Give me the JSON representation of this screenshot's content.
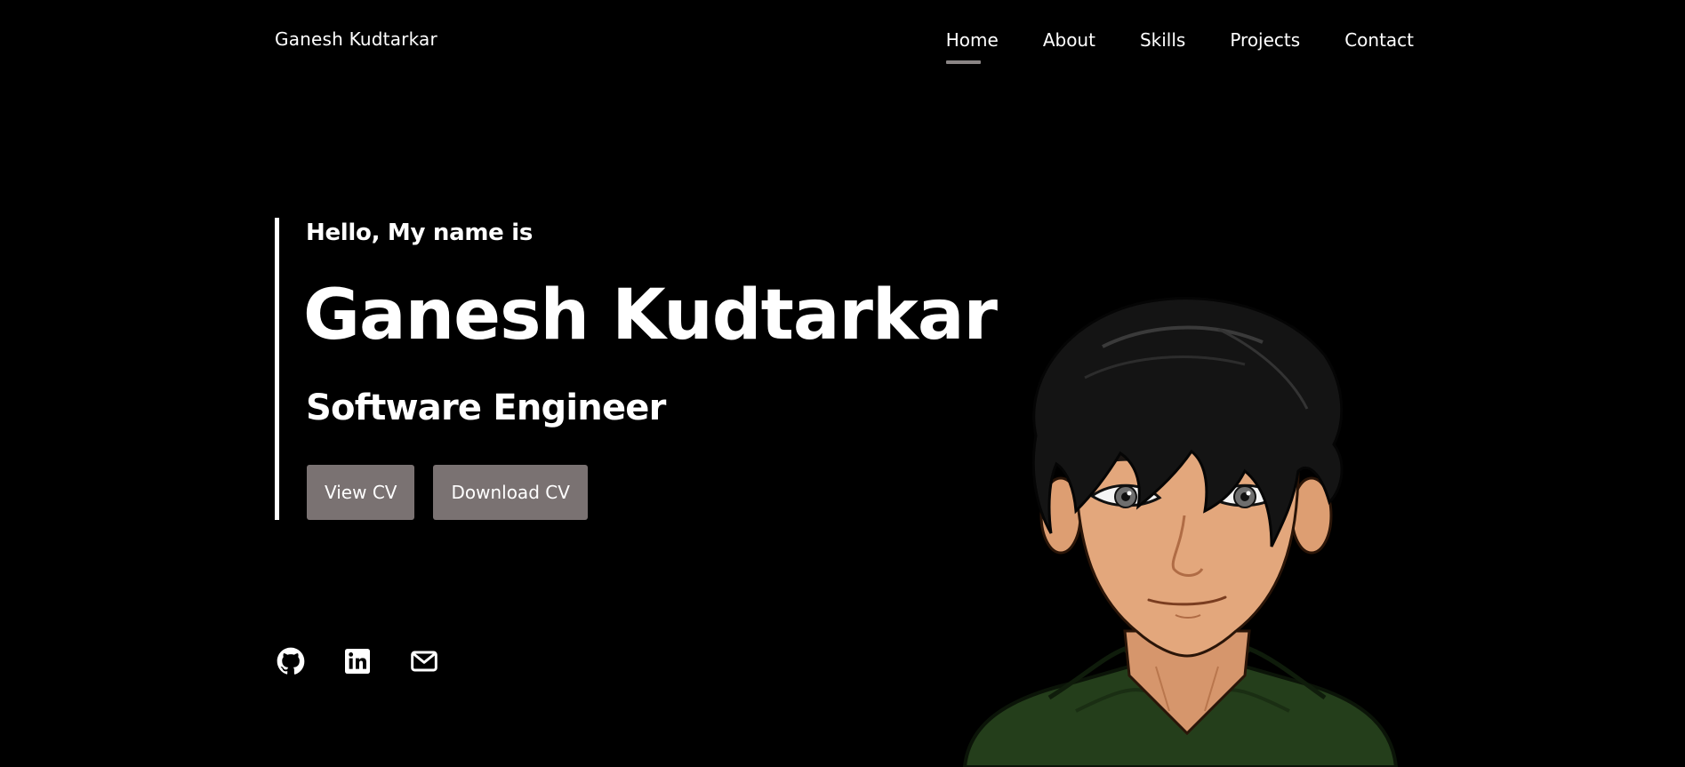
{
  "nav": {
    "brand": "Ganesh Kudtarkar",
    "items": [
      {
        "label": "Home",
        "active": true
      },
      {
        "label": "About"
      },
      {
        "label": "Skills"
      },
      {
        "label": "Projects"
      },
      {
        "label": "Contact"
      }
    ]
  },
  "hero": {
    "greeting": "Hello, My name is",
    "name": "Ganesh Kudtarkar",
    "role": "Software Engineer",
    "buttons": {
      "view_cv": "View CV",
      "download_cv": "Download CV"
    }
  },
  "social": {
    "icons": [
      "github-icon",
      "linkedin-icon",
      "mail-icon"
    ]
  },
  "colors": {
    "background": "#000000",
    "text": "#ffffff",
    "button": "#7a7272",
    "active_underline": "#8a8585",
    "hoodie": "#2a4a1f",
    "skin": "#e3a77c",
    "hair": "#141414"
  }
}
